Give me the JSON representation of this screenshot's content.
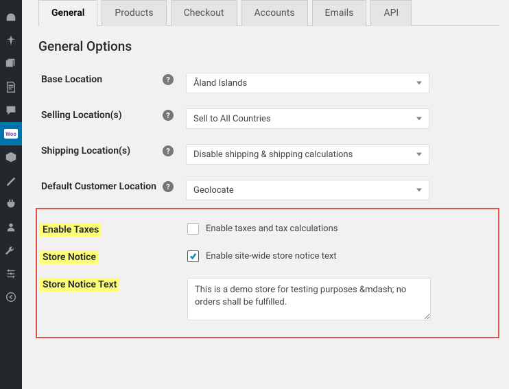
{
  "tabs": [
    "General",
    "Products",
    "Checkout",
    "Accounts",
    "Emails",
    "API"
  ],
  "activeTab": 0,
  "sectionTitle": "General Options",
  "labels": {
    "baseLocation": "Base Location",
    "sellingLocations": "Selling Location(s)",
    "shippingLocations": "Shipping Location(s)",
    "defaultCustomerLocation": "Default Customer Location",
    "enableTaxes": "Enable Taxes",
    "storeNotice": "Store Notice",
    "storeNoticeText": "Store Notice Text"
  },
  "values": {
    "baseLocation": "Åland Islands",
    "sellingLocations": "Sell to All Countries",
    "shippingLocations": "Disable shipping & shipping calculations",
    "defaultCustomerLocation": "Geolocate",
    "enableTaxesChecked": false,
    "enableTaxesLabel": "Enable taxes and tax calculations",
    "storeNoticeChecked": true,
    "storeNoticeLabel": "Enable site-wide store notice text",
    "storeNoticeText": "This is a demo store for testing purposes &mdash; no orders shall be fulfilled."
  },
  "sidebarIcons": [
    "dashboard",
    "pin",
    "media",
    "pages",
    "comments",
    "woocommerce",
    "products",
    "plugins",
    "tools",
    "users",
    "settings",
    "import",
    "collapse"
  ]
}
